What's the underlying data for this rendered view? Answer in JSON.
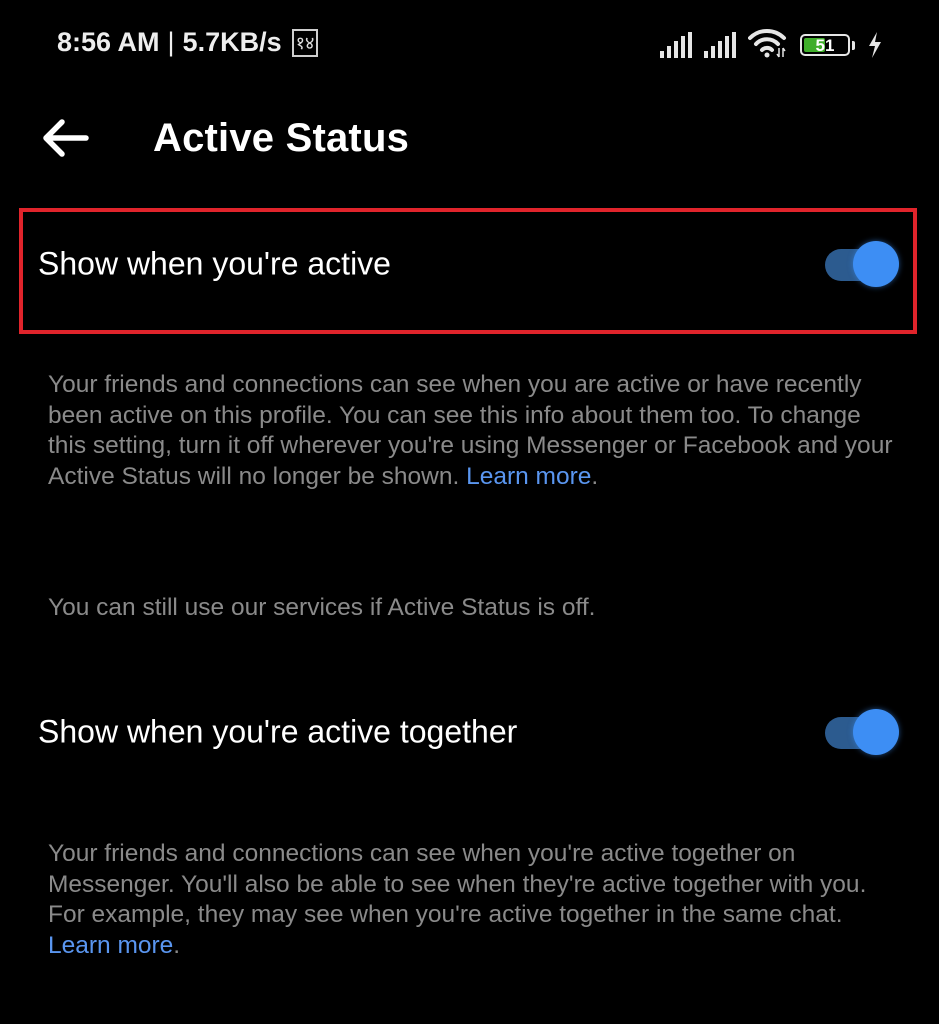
{
  "status_bar": {
    "time": "8:56 AM",
    "separator": "|",
    "network_speed": "5.7KB/s",
    "notification_glyph": "१४",
    "signal_icons": [
      "signal-sim1-icon",
      "signal-sim2-icon"
    ],
    "wifi_icon": "wifi-icon",
    "battery_level": "51",
    "battery_percent": 51,
    "charging_icon": "lightning-bolt-icon",
    "battery_color": "#3fae2a"
  },
  "header": {
    "back_icon": "arrow-left-icon",
    "title": "Active Status"
  },
  "settings": [
    {
      "label": "Show when you're active",
      "enabled": true,
      "highlighted": true,
      "description": "Your friends and connections can see when you are active or have recently been active on this profile. You can see this info about them too. To change this setting, turn it off wherever you're using Messenger or Facebook and your Active Status will no longer be shown. ",
      "learn_more": "Learn more",
      "trailing": "."
    },
    {
      "label": "Show when you're active together",
      "enabled": true,
      "highlighted": false,
      "description": "Your friends and connections can see when you're active together on Messenger. You'll also be able to see when they're active together with you. For example, they may see when you're active together in the same chat. ",
      "learn_more": "Learn more",
      "trailing": "."
    }
  ],
  "note": "You can still use our services if Active Status is off.",
  "colors": {
    "background": "#000000",
    "toggle_thumb": "#3d8ef4",
    "toggle_track": "#2c5b8f",
    "link": "#5a96f0",
    "highlight_frame": "#e0242b",
    "secondary_text": "#8a8a8a"
  }
}
